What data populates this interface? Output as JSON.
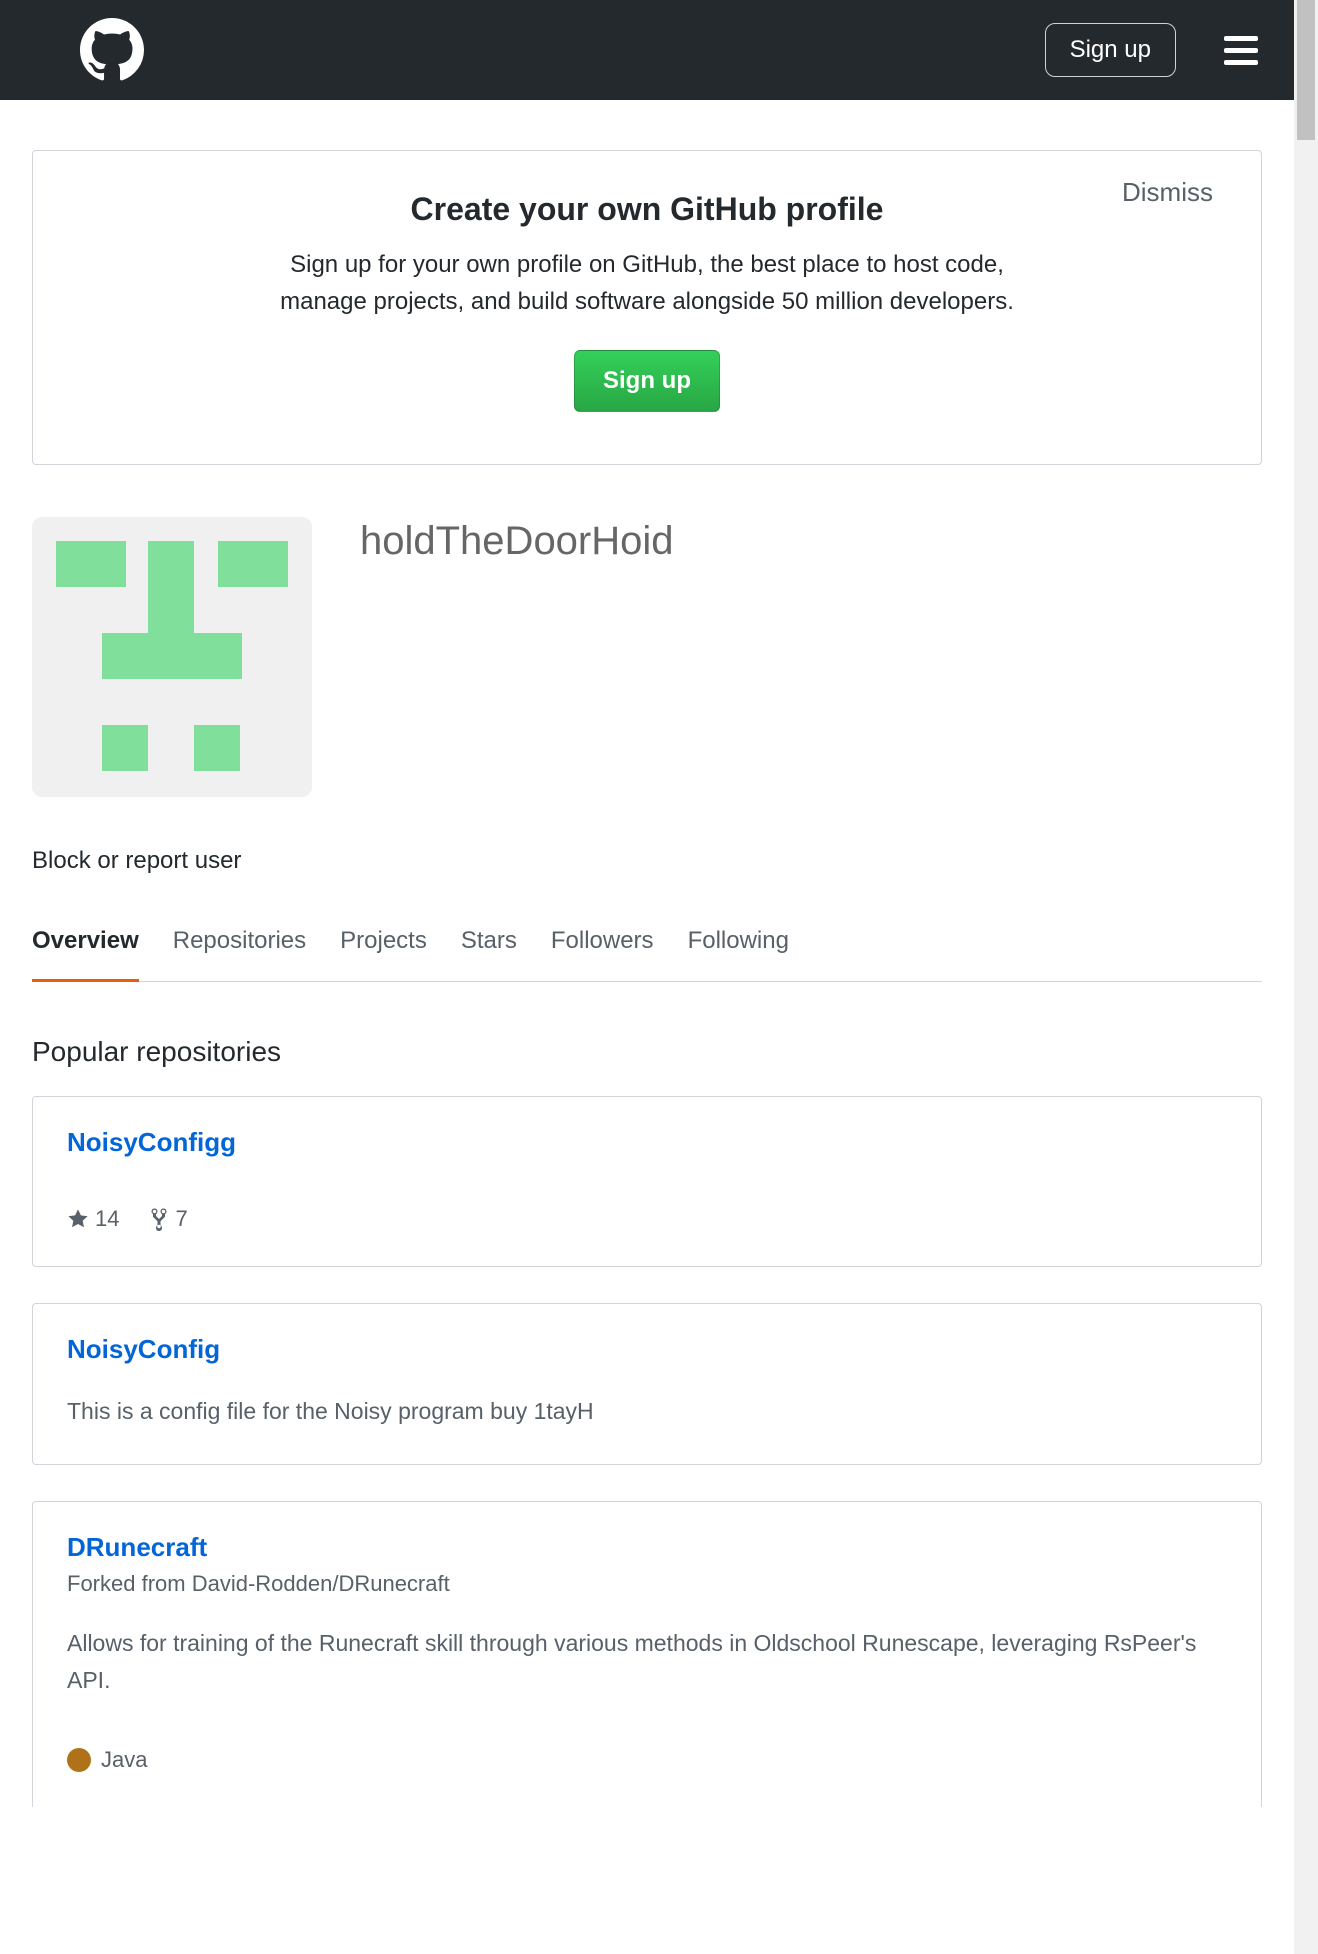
{
  "header": {
    "signup_label": "Sign up"
  },
  "banner": {
    "dismiss_label": "Dismiss",
    "title": "Create your own GitHub profile",
    "body": "Sign up for your own profile on GitHub, the best place to host code, manage projects, and build software alongside 50 million developers.",
    "cta_label": "Sign up"
  },
  "profile": {
    "username": "holdTheDoorHoid",
    "block_link": "Block or report user"
  },
  "tabs": [
    {
      "label": "Overview",
      "active": true
    },
    {
      "label": "Repositories",
      "active": false
    },
    {
      "label": "Projects",
      "active": false
    },
    {
      "label": "Stars",
      "active": false
    },
    {
      "label": "Followers",
      "active": false
    },
    {
      "label": "Following",
      "active": false
    }
  ],
  "section_title": "Popular repositories",
  "repos": [
    {
      "name": "NoisyConfigg",
      "stars": "14",
      "forks": "7"
    },
    {
      "name": "NoisyConfig",
      "description": "This is a config file for the Noisy program buy 1tayH"
    },
    {
      "name": "DRunecraft",
      "forked_from": "Forked from David-Rodden/DRunecraft",
      "description": "Allows for training of the Runecraft skill through various methods in Oldschool Runescape, leveraging RsPeer's API.",
      "language": "Java",
      "language_color": "#b07219"
    }
  ]
}
